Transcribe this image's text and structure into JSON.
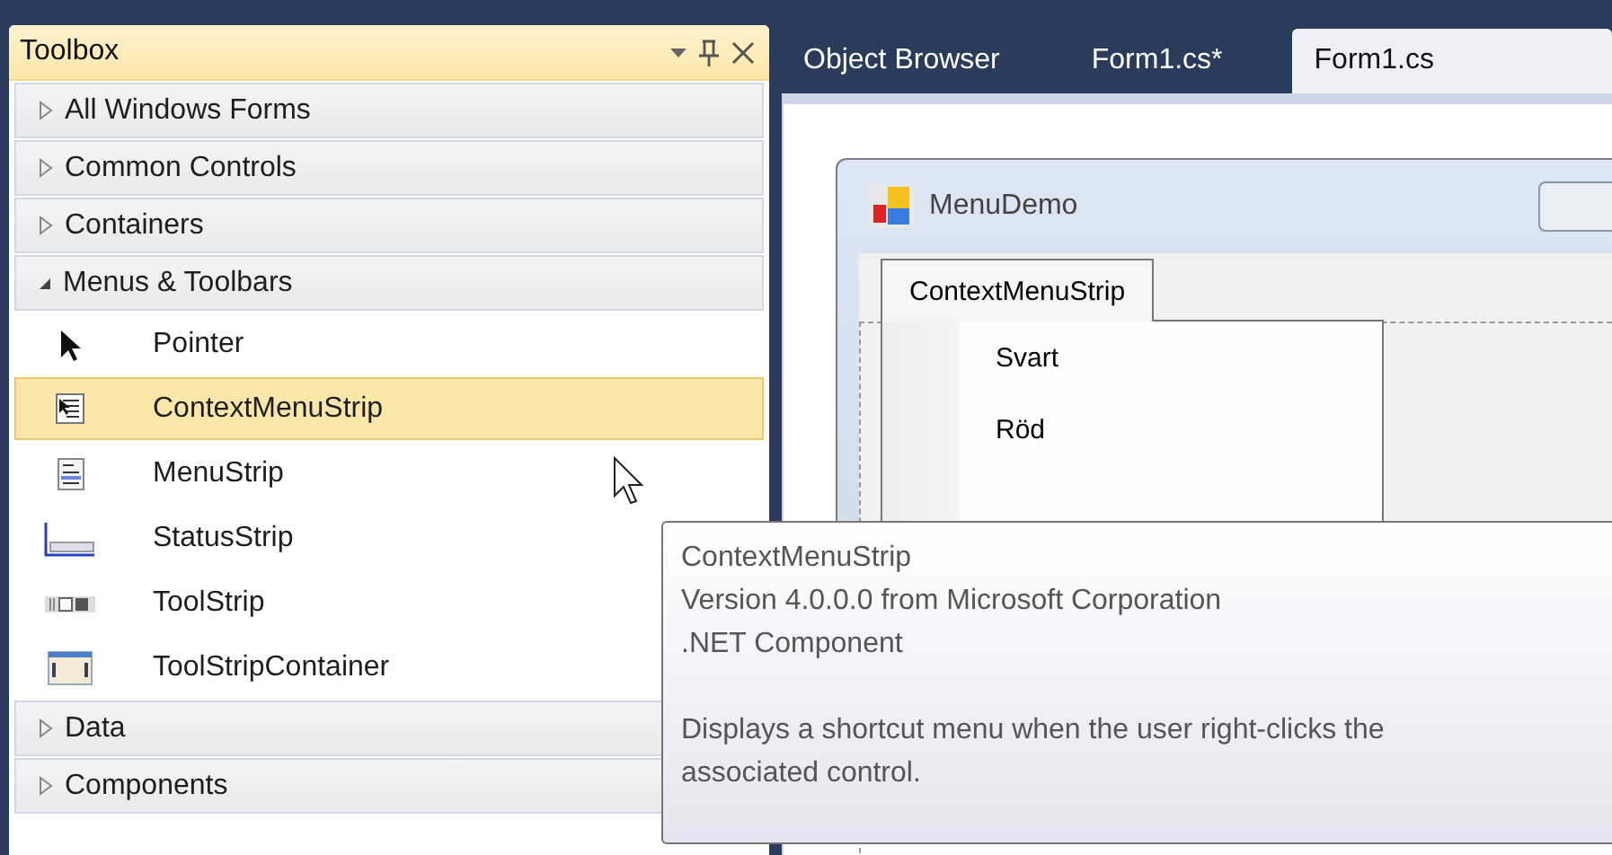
{
  "toolbox": {
    "title": "Toolbox",
    "groups": [
      {
        "label": "All Windows Forms",
        "expanded": false
      },
      {
        "label": "Common Controls",
        "expanded": false
      },
      {
        "label": "Containers",
        "expanded": false
      },
      {
        "label": "Menus & Toolbars",
        "expanded": true,
        "items": [
          {
            "label": "Pointer",
            "kind": "pointer",
            "selected": false
          },
          {
            "label": "ContextMenuStrip",
            "kind": "contextmenu",
            "selected": true
          },
          {
            "label": "MenuStrip",
            "kind": "menustrip",
            "selected": false
          },
          {
            "label": "StatusStrip",
            "kind": "statusstrip",
            "selected": false
          },
          {
            "label": "ToolStrip",
            "kind": "toolstrip",
            "selected": false
          },
          {
            "label": "ToolStripContainer",
            "kind": "container",
            "selected": false
          }
        ]
      },
      {
        "label": "Data",
        "expanded": false
      },
      {
        "label": "Components",
        "expanded": false
      }
    ]
  },
  "tabs": [
    {
      "label": "Object Browser",
      "selected": false
    },
    {
      "label": "Form1.cs*",
      "selected": false
    },
    {
      "label": "Form1.cs",
      "selected": true
    }
  ],
  "designer": {
    "form_title": "MenuDemo",
    "strip_label": "ContextMenuStrip",
    "menu_items": [
      "Svart",
      "Röd"
    ]
  },
  "tooltip": {
    "lines": [
      "ContextMenuStrip",
      "Version 4.0.0.0 from Microsoft Corporation",
      ".NET Component"
    ],
    "description": "Displays a shortcut menu when the user right-clicks the associated control."
  }
}
